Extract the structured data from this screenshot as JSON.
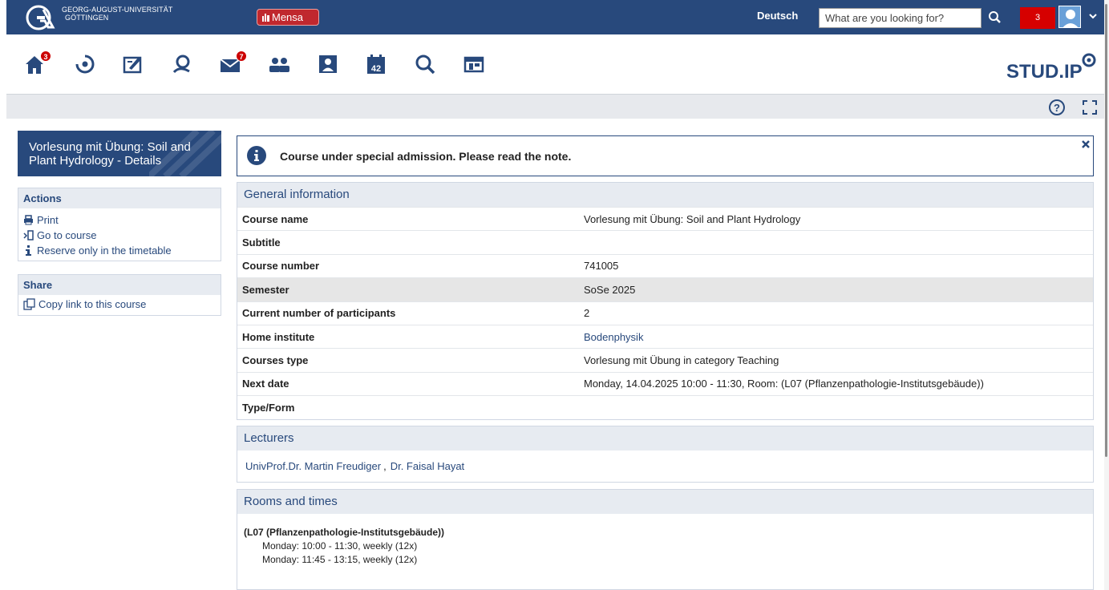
{
  "topbar": {
    "university_name_line1": "GEORG-AUGUST-UNIVERSITÄT",
    "university_name_line2": "GÖTTINGEN",
    "mensa_label": "Mensa",
    "language": "Deutsch",
    "search_placeholder": "What are you looking for?",
    "notification_count": "3",
    "bar_color": "#28497c"
  },
  "nav": {
    "items": [
      {
        "icon": "home-icon",
        "badge": "3"
      },
      {
        "icon": "activity-icon"
      },
      {
        "icon": "courses-icon"
      },
      {
        "icon": "community-icon"
      },
      {
        "icon": "messages-icon",
        "badge": "7"
      },
      {
        "icon": "contacts-icon"
      },
      {
        "icon": "profile-icon"
      },
      {
        "icon": "calendar-icon",
        "label": "42"
      },
      {
        "icon": "search-icon"
      },
      {
        "icon": "tools-icon"
      }
    ],
    "brand": "STUD.IP"
  },
  "sidebar": {
    "title": "Vorlesung mit Übung: Soil and Plant Hydrology - Details",
    "actions_heading": "Actions",
    "actions": [
      {
        "icon": "print-icon",
        "label": "Print"
      },
      {
        "icon": "enter-icon",
        "label": "Go to course"
      },
      {
        "icon": "info-icon",
        "label": "Reserve only in the timetable"
      }
    ],
    "share_heading": "Share",
    "share_items": [
      {
        "icon": "copy-link-icon",
        "label": "Copy link to this course"
      }
    ]
  },
  "notice": {
    "text": "Course under special admission. Please read the note."
  },
  "general": {
    "heading": "General information",
    "rows": [
      {
        "key": "Course name",
        "value": "Vorlesung mit Übung: Soil and Plant Hydrology"
      },
      {
        "key": "Subtitle",
        "value": ""
      },
      {
        "key": "Course number",
        "value": "741005"
      },
      {
        "key": "Semester",
        "value": "SoSe 2025"
      },
      {
        "key": "Current number of participants",
        "value": "2"
      },
      {
        "key": "Home institute",
        "value": "Bodenphysik"
      },
      {
        "key": "Courses type",
        "value": "Vorlesung mit Übung in category Teaching"
      },
      {
        "key": "Next date",
        "value": "Monday, 14.04.2025 10:00 - 11:30, Room: (L07 (Pflanzenpathologie-Institutsgebäude))"
      },
      {
        "key": "Type/Form",
        "value": ""
      }
    ]
  },
  "lecturers": {
    "heading": "Lecturers",
    "names": [
      "UnivProf.Dr. Martin Freudiger",
      "Dr. Faisal Hayat"
    ],
    "separator": ","
  },
  "rooms": {
    "heading": "Rooms and times",
    "room": "(L07 (Pflanzenpathologie-Institutsgebäude))",
    "slots": [
      "Monday: 10:00 - 11:30, weekly (12x)",
      "Monday: 11:45 - 13:15, weekly (12x)"
    ]
  }
}
